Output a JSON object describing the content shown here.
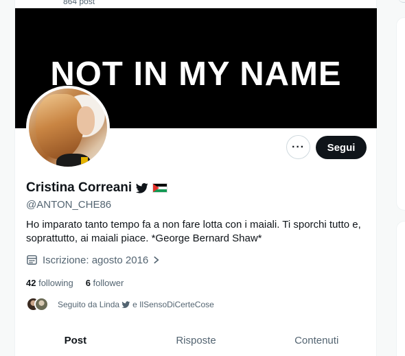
{
  "header": {
    "post_count": "864 post"
  },
  "banner": {
    "text": "NOT IN MY NAME"
  },
  "profile": {
    "name": "Cristina Correani",
    "handle": "@ANTON_CHE86",
    "bio": "Ho imparato tanto tempo fa a non fare lotta con i maiali. Ti sporchi tutto e, soprattutto, ai maiali piace. *George Bernard Shaw*",
    "joined": "Iscrizione: agosto 2016",
    "following_count": "42",
    "following_label": "following",
    "followers_count": "6",
    "followers_label": "follower",
    "followed_by_prefix": "Seguito da Linda",
    "followed_by_suffix": "e IlSensoDiCerteCose"
  },
  "actions": {
    "more_label": "···",
    "follow_label": "Segui"
  },
  "tabs": [
    {
      "label": "Post",
      "active": true
    },
    {
      "label": "Risposte",
      "active": false
    },
    {
      "label": "Contenuti",
      "active": false
    }
  ],
  "icons": {
    "name_badges": [
      "twitter-bird-icon",
      "palestine-flag-icon"
    ],
    "joined": "calendar-icon",
    "joined_chevron": "chevron-right-icon"
  },
  "colors": {
    "text": "#0f1419",
    "muted": "#536471",
    "follow_button_bg": "#0f1419",
    "banner_bg": "#000000"
  }
}
